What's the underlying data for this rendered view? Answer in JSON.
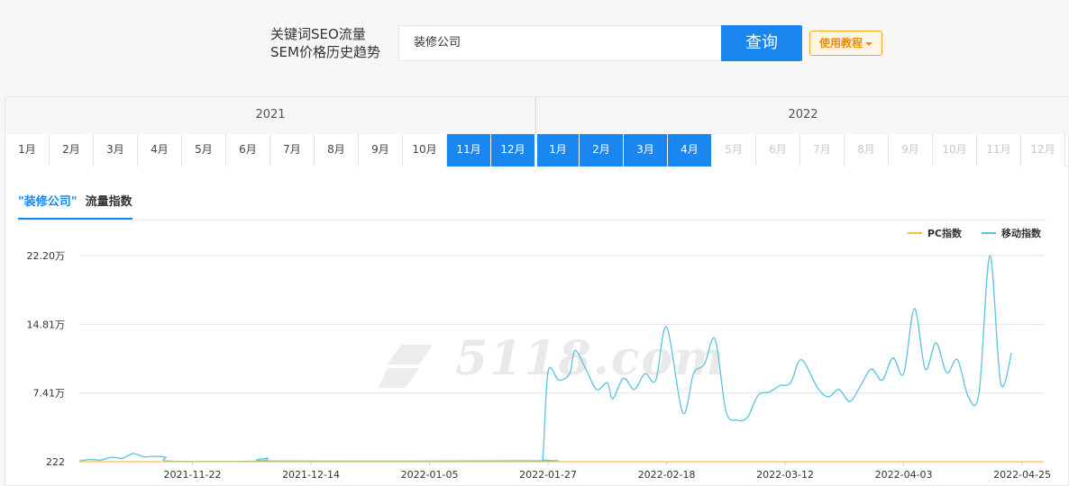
{
  "header": {
    "brand_line1": "关键词SEO流量",
    "brand_line2": "SEM价格历史趋势",
    "search_value": "装修公司",
    "search_button": "查询",
    "tutorial_button": "使用教程"
  },
  "years": [
    "2021",
    "2022"
  ],
  "months_2021": [
    "1月",
    "2月",
    "3月",
    "4月",
    "5月",
    "6月",
    "7月",
    "8月",
    "9月",
    "10月",
    "11月",
    "12月"
  ],
  "months_2022": [
    "1月",
    "2月",
    "3月",
    "4月",
    "5月",
    "6月",
    "7月",
    "8月",
    "9月",
    "10月",
    "11月",
    "12月"
  ],
  "active_months": {
    "2021": [
      "11月",
      "12月"
    ],
    "2022": [
      "1月",
      "2月",
      "3月",
      "4月"
    ]
  },
  "tab": {
    "keyword": "\"装修公司\"",
    "label": "流量指数"
  },
  "legend": {
    "pc": "PC指数",
    "mobile": "移动指数"
  },
  "colors": {
    "accent": "#1a87f0",
    "pc": "#f5c04a",
    "mobile": "#5bc2df",
    "tutorial": "#f08a00"
  },
  "watermark": "5118.com",
  "chart_data": {
    "type": "line",
    "y_tick_labels": [
      "222",
      "7.41万",
      "14.81万",
      "22.20万"
    ],
    "y_tick_values": [
      222,
      74100,
      148100,
      222000
    ],
    "ylim": [
      222,
      222000
    ],
    "x_tick_labels": [
      "2021-11-22",
      "2021-12-14",
      "2022-01-05",
      "2022-01-27",
      "2022-02-18",
      "2022-03-12",
      "2022-04-03",
      "2022-04-25"
    ],
    "x_range": [
      "2021-11-01",
      "2022-04-29"
    ],
    "grid": true,
    "legend_position": "top-right",
    "series": [
      {
        "name": "PC指数",
        "color": "#f5c04a",
        "points": [
          [
            "2021-11-01",
            222
          ],
          [
            "2022-01-27",
            222
          ],
          [
            "2022-04-29",
            222
          ]
        ]
      },
      {
        "name": "移动指数",
        "color": "#5bc2df",
        "points": [
          [
            "2021-11-01",
            1000
          ],
          [
            "2021-11-03",
            2500
          ],
          [
            "2021-11-05",
            2000
          ],
          [
            "2021-11-07",
            5000
          ],
          [
            "2021-11-09",
            4000
          ],
          [
            "2021-11-11",
            9000
          ],
          [
            "2021-11-13",
            5500
          ],
          [
            "2021-11-15",
            6000
          ],
          [
            "2021-11-17",
            5000
          ],
          [
            "2021-11-18",
            800
          ],
          [
            "2021-12-04",
            900
          ],
          [
            "2021-12-06",
            4000
          ],
          [
            "2021-12-08",
            900
          ],
          [
            "2022-01-25",
            1200
          ],
          [
            "2022-01-26",
            3000
          ],
          [
            "2022-01-27",
            97000
          ],
          [
            "2022-01-29",
            88000
          ],
          [
            "2022-01-31",
            95000
          ],
          [
            "2022-02-01",
            120000
          ],
          [
            "2022-02-03",
            100000
          ],
          [
            "2022-02-05",
            78000
          ],
          [
            "2022-02-07",
            85000
          ],
          [
            "2022-02-08",
            68000
          ],
          [
            "2022-02-10",
            90000
          ],
          [
            "2022-02-12",
            78000
          ],
          [
            "2022-02-14",
            95000
          ],
          [
            "2022-02-16",
            88000
          ],
          [
            "2022-02-18",
            145000
          ],
          [
            "2022-02-21",
            53000
          ],
          [
            "2022-02-23",
            95000
          ],
          [
            "2022-02-25",
            105000
          ],
          [
            "2022-02-27",
            132000
          ],
          [
            "2022-03-01",
            55000
          ],
          [
            "2022-03-03",
            45000
          ],
          [
            "2022-03-05",
            48000
          ],
          [
            "2022-03-07",
            72000
          ],
          [
            "2022-03-09",
            75000
          ],
          [
            "2022-03-11",
            82000
          ],
          [
            "2022-03-13",
            85000
          ],
          [
            "2022-03-15",
            110000
          ],
          [
            "2022-03-18",
            80000
          ],
          [
            "2022-03-20",
            70000
          ],
          [
            "2022-03-22",
            78000
          ],
          [
            "2022-03-24",
            65000
          ],
          [
            "2022-03-26",
            82000
          ],
          [
            "2022-03-28",
            100000
          ],
          [
            "2022-03-30",
            88000
          ],
          [
            "2022-04-01",
            112000
          ],
          [
            "2022-04-03",
            95000
          ],
          [
            "2022-04-05",
            165000
          ],
          [
            "2022-04-07",
            100000
          ],
          [
            "2022-04-09",
            128000
          ],
          [
            "2022-04-11",
            96000
          ],
          [
            "2022-04-13",
            110000
          ],
          [
            "2022-04-15",
            70000
          ],
          [
            "2022-04-17",
            75000
          ],
          [
            "2022-04-19",
            222000
          ],
          [
            "2022-04-21",
            85000
          ],
          [
            "2022-04-23",
            117000
          ]
        ]
      }
    ]
  }
}
